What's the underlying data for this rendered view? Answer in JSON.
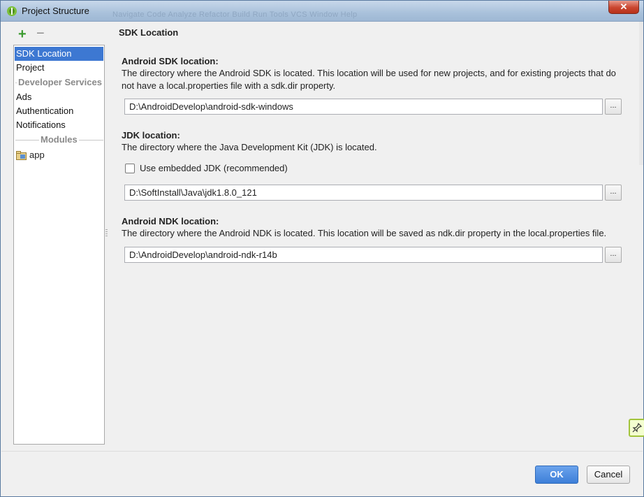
{
  "window": {
    "title": "Project Structure",
    "background_menu_ghost": "Navigate Code Analyze Refactor Build Run Tools VCS Window Help",
    "close_label": "✕"
  },
  "toolbar": {
    "add_label": "+",
    "remove_label": "−"
  },
  "sidebar": {
    "items": [
      {
        "label": "SDK Location",
        "selected": true
      },
      {
        "label": "Project"
      }
    ],
    "developer_services_header": "Developer Services",
    "developer_services": [
      {
        "label": "Ads"
      },
      {
        "label": "Authentication"
      },
      {
        "label": "Notifications"
      }
    ],
    "modules_header": "Modules",
    "modules": [
      {
        "label": "app"
      }
    ]
  },
  "panel": {
    "title": "SDK Location",
    "android_sdk": {
      "title": "Android SDK location:",
      "description": "The directory where the Android SDK is located. This location will be used for new projects, and for existing projects that do not have a local.properties file with a sdk.dir property.",
      "path": "D:\\AndroidDevelop\\android-sdk-windows",
      "browse_label": "..."
    },
    "jdk": {
      "title": "JDK location:",
      "description": "The directory where the Java Development Kit (JDK) is located.",
      "embedded_checkbox_label": "Use embedded JDK (recommended)",
      "embedded_checked": false,
      "path": "D:\\SoftInstall\\Java\\jdk1.8.0_121",
      "browse_label": "..."
    },
    "android_ndk": {
      "title": "Android NDK location:",
      "description": "The directory where the Android NDK is located. This location will be saved as ndk.dir property in the local.properties file.",
      "path": "D:\\AndroidDevelop\\android-ndk-r14b",
      "browse_label": "..."
    }
  },
  "buttons": {
    "ok": "OK",
    "cancel": "Cancel"
  },
  "colors": {
    "accent": "#3d78d2",
    "add_green": "#3a9a2e",
    "ok_blue": "#4a8ae0"
  }
}
